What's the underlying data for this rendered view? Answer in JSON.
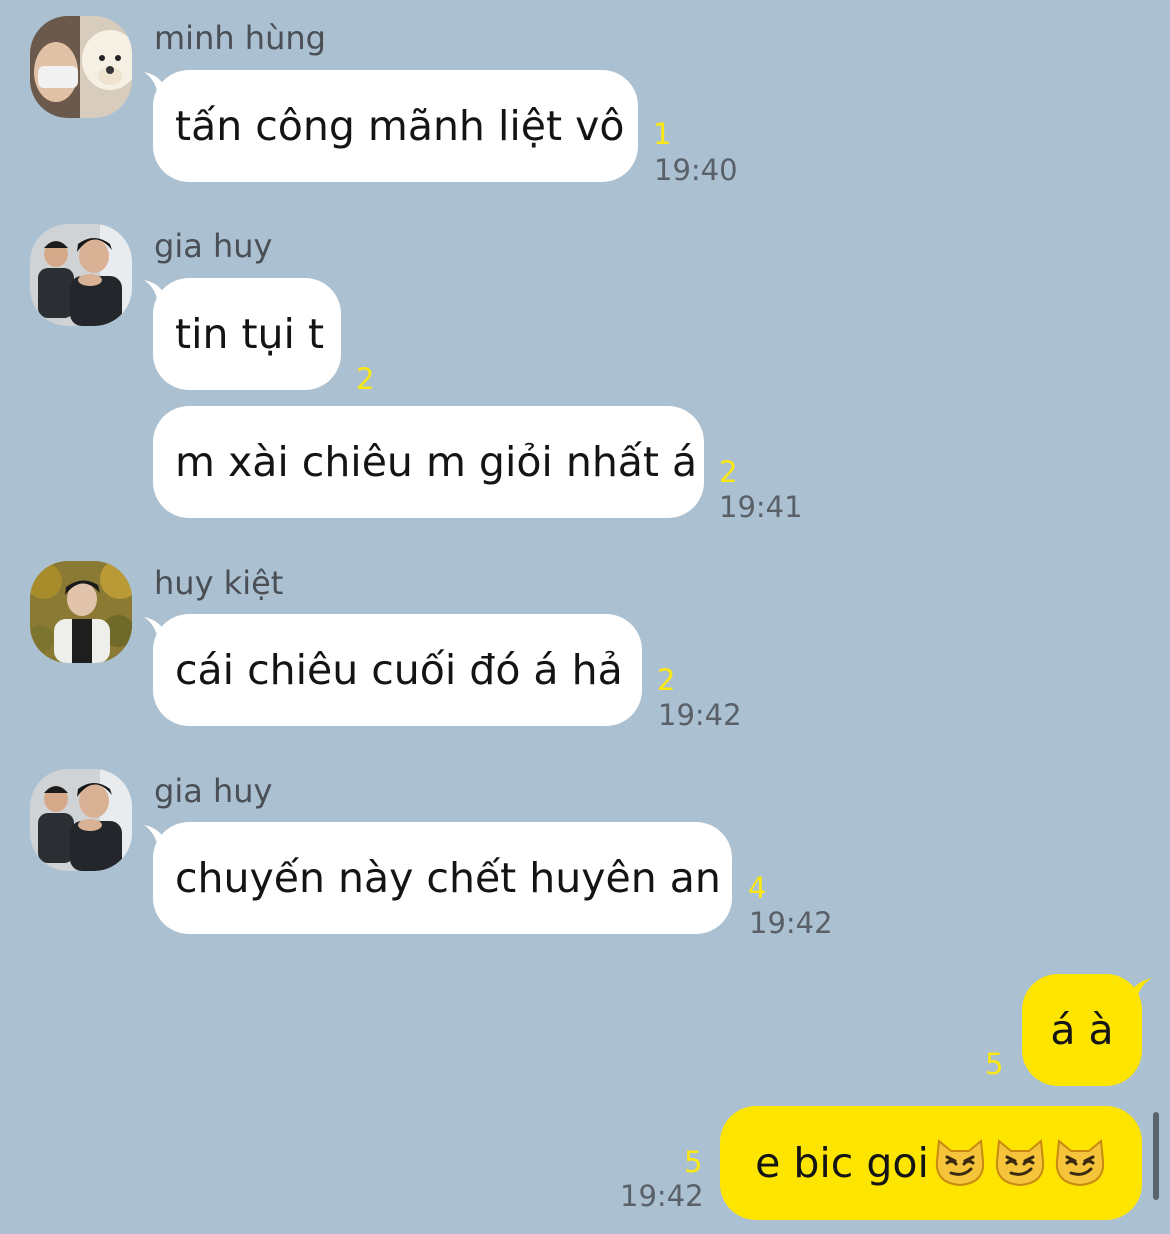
{
  "colors": {
    "background": "#abc1d1",
    "incoming_bubble": "#ffffff",
    "outgoing_bubble": "#fee500",
    "unread_count": "#fbe711",
    "timestamp": "#5a6068"
  },
  "messages": [
    {
      "sender": "minh hùng",
      "text": "tấn công mãnh liệt vô",
      "unread": "1",
      "time": "19:40"
    },
    {
      "sender": "gia huy",
      "text": "tin tụi t",
      "unread": "2",
      "time": ""
    },
    {
      "sender": "",
      "text": "m xài chiêu m giỏi nhất á",
      "unread": "2",
      "time": "19:41"
    },
    {
      "sender": "huy kiệt",
      "text": "cái chiêu cuối đó á hả",
      "unread": "2",
      "time": "19:42"
    },
    {
      "sender": "gia huy",
      "text": "chuyến này chết huyên an",
      "unread": "4",
      "time": "19:42"
    },
    {
      "sender": "",
      "text": "á à",
      "unread": "5",
      "time": ""
    },
    {
      "sender": "",
      "text": "e bic goi",
      "emoji": "smirking-cat-face-icon x3",
      "unread": "5",
      "time": "19:42"
    }
  ]
}
